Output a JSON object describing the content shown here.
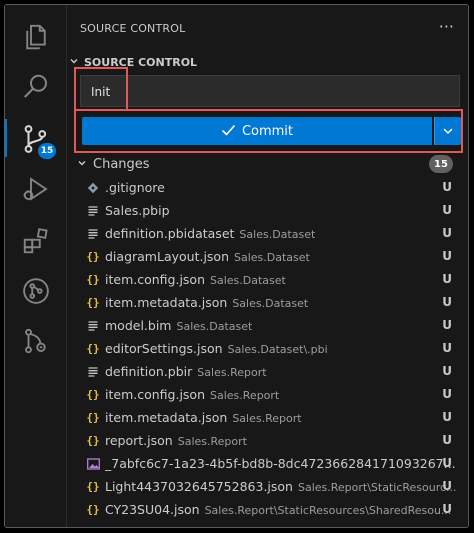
{
  "header": {
    "title": "SOURCE CONTROL",
    "more": "···"
  },
  "section": {
    "title": "SOURCE CONTROL"
  },
  "message": {
    "value": "Init"
  },
  "commit": {
    "label": "Commit"
  },
  "activity": {
    "scm_badge": "15"
  },
  "changes": {
    "label": "Changes",
    "count": "15",
    "files": [
      {
        "icon": "git-icon",
        "name": ".gitignore",
        "dir": "",
        "status": "U"
      },
      {
        "icon": "lines-icon",
        "name": "Sales.pbip",
        "dir": "",
        "status": "U"
      },
      {
        "icon": "lines-icon",
        "name": "definition.pbidataset",
        "dir": "Sales.Dataset",
        "status": "U"
      },
      {
        "icon": "json-icon",
        "name": "diagramLayout.json",
        "dir": "Sales.Dataset",
        "status": "U"
      },
      {
        "icon": "json-icon",
        "name": "item.config.json",
        "dir": "Sales.Dataset",
        "status": "U"
      },
      {
        "icon": "json-icon",
        "name": "item.metadata.json",
        "dir": "Sales.Dataset",
        "status": "U"
      },
      {
        "icon": "lines-icon",
        "name": "model.bim",
        "dir": "Sales.Dataset",
        "status": "U"
      },
      {
        "icon": "json-icon",
        "name": "editorSettings.json",
        "dir": "Sales.Dataset\\.pbi",
        "status": "U"
      },
      {
        "icon": "lines-icon",
        "name": "definition.pbir",
        "dir": "Sales.Report",
        "status": "U"
      },
      {
        "icon": "json-icon",
        "name": "item.config.json",
        "dir": "Sales.Report",
        "status": "U"
      },
      {
        "icon": "json-icon",
        "name": "item.metadata.json",
        "dir": "Sales.Report",
        "status": "U"
      },
      {
        "icon": "json-icon",
        "name": "report.json",
        "dir": "Sales.Report",
        "status": "U"
      },
      {
        "icon": "image-icon",
        "name": "_7abfc6c7-1a23-4b5f-bd8b-8dc472366284171093267...",
        "dir": "",
        "status": "U"
      },
      {
        "icon": "json-icon",
        "name": "Light4437032645752863.json",
        "dir": "Sales.Report\\StaticResourc...",
        "status": "U"
      },
      {
        "icon": "json-icon",
        "name": "CY23SU04.json",
        "dir": "Sales.Report\\StaticResources\\SharedResou...",
        "status": "U"
      }
    ]
  },
  "colors": {
    "accent": "#0078d4",
    "highlight": "#e05a5a",
    "json_icon": "#e2c04a",
    "image_icon": "#b180d7"
  }
}
